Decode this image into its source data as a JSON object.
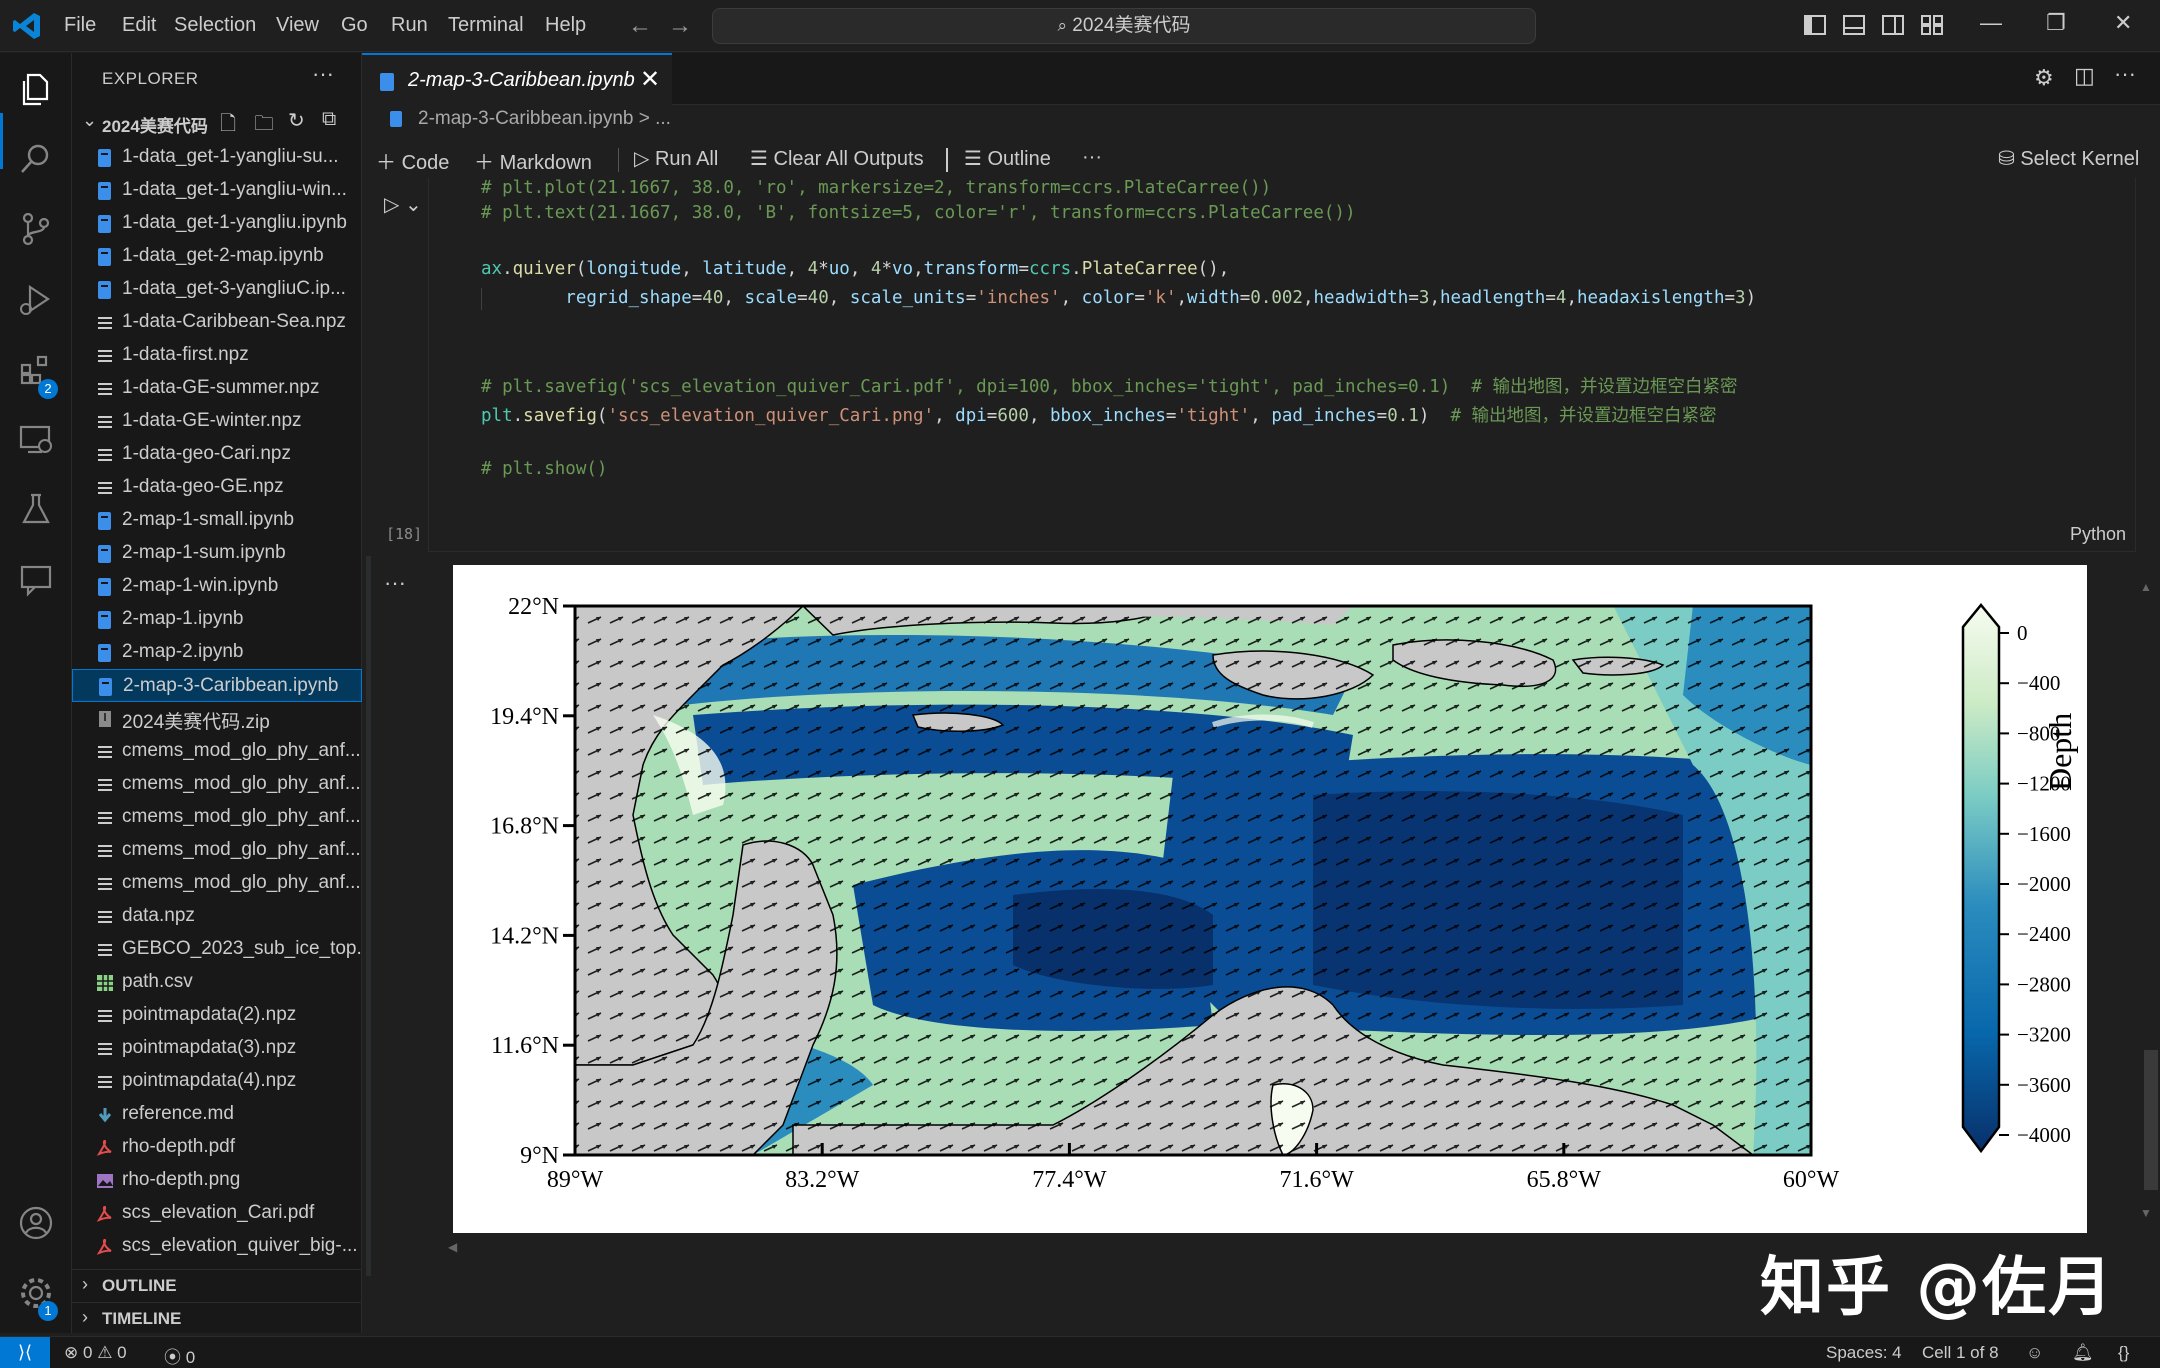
{
  "titlebar": {
    "menu": [
      "File",
      "Edit",
      "Selection",
      "View",
      "Go",
      "Run",
      "Terminal",
      "Help"
    ],
    "search_text": "2024美赛代码"
  },
  "activitybar": {
    "extensions_badge": "2",
    "settings_badge": "1"
  },
  "sidebar": {
    "title": "EXPLORER",
    "folder": "2024美赛代码",
    "files": [
      {
        "name": "1-data_get-1-yangliu-su...",
        "icon": "notebook"
      },
      {
        "name": "1-data_get-1-yangliu-win...",
        "icon": "notebook"
      },
      {
        "name": "1-data_get-1-yangliu.ipynb",
        "icon": "notebook"
      },
      {
        "name": "1-data_get-2-map.ipynb",
        "icon": "notebook"
      },
      {
        "name": "1-data_get-3-yangliuC.ip...",
        "icon": "notebook"
      },
      {
        "name": "1-data-Caribbean-Sea.npz",
        "icon": "lines"
      },
      {
        "name": "1-data-first.npz",
        "icon": "lines"
      },
      {
        "name": "1-data-GE-summer.npz",
        "icon": "lines"
      },
      {
        "name": "1-data-GE-winter.npz",
        "icon": "lines"
      },
      {
        "name": "1-data-geo-Cari.npz",
        "icon": "lines"
      },
      {
        "name": "1-data-geo-GE.npz",
        "icon": "lines"
      },
      {
        "name": "2-map-1-small.ipynb",
        "icon": "notebook"
      },
      {
        "name": "2-map-1-sum.ipynb",
        "icon": "notebook"
      },
      {
        "name": "2-map-1-win.ipynb",
        "icon": "notebook"
      },
      {
        "name": "2-map-1.ipynb",
        "icon": "notebook"
      },
      {
        "name": "2-map-2.ipynb",
        "icon": "notebook"
      },
      {
        "name": "2-map-3-Caribbean.ipynb",
        "icon": "notebook",
        "active": true
      },
      {
        "name": "2024美赛代码.zip",
        "icon": "zip"
      },
      {
        "name": "cmems_mod_glo_phy_anf...",
        "icon": "lines"
      },
      {
        "name": "cmems_mod_glo_phy_anf...",
        "icon": "lines"
      },
      {
        "name": "cmems_mod_glo_phy_anf...",
        "icon": "lines"
      },
      {
        "name": "cmems_mod_glo_phy_anf...",
        "icon": "lines"
      },
      {
        "name": "cmems_mod_glo_phy_anf...",
        "icon": "lines"
      },
      {
        "name": "data.npz",
        "icon": "lines"
      },
      {
        "name": "GEBCO_2023_sub_ice_top...",
        "icon": "lines"
      },
      {
        "name": "path.csv",
        "icon": "csv"
      },
      {
        "name": "pointmapdata(2).npz",
        "icon": "lines"
      },
      {
        "name": "pointmapdata(3).npz",
        "icon": "lines"
      },
      {
        "name": "pointmapdata(4).npz",
        "icon": "lines"
      },
      {
        "name": "reference.md",
        "icon": "markdown"
      },
      {
        "name": "rho-depth.pdf",
        "icon": "pdf"
      },
      {
        "name": "rho-depth.png",
        "icon": "image"
      },
      {
        "name": "scs_elevation_Cari.pdf",
        "icon": "pdf"
      },
      {
        "name": "scs_elevation_quiver_big-...",
        "icon": "pdf"
      }
    ],
    "sections": [
      "OUTLINE",
      "TIMELINE"
    ]
  },
  "editor": {
    "tab_label": "2-map-3-Caribbean.ipynb",
    "breadcrumb": "2-map-3-Caribbean.ipynb > ...",
    "toolbar": {
      "code": "Code",
      "markdown": "Markdown",
      "run_all": "Run All",
      "clear_outputs": "Clear All Outputs",
      "outline": "Outline",
      "select_kernel": "Select Kernel"
    },
    "cell": {
      "exec_count": "[18]",
      "language": "Python",
      "lines": [
        "# plt.plot(21.1667, 38.0, 'ro', markersize=2, transform=ccrs.PlateCarree())",
        "# plt.text(21.1667, 38.0, 'B', fontsize=5, color='r', transform=ccrs.PlateCarree())",
        "",
        "ax.quiver(longitude, latitude, 4*uo, 4*vo,transform=ccrs.PlateCarree(),",
        "        regrid_shape=40, scale=40, scale_units='inches', color='k',width=0.002,headwidth=3,headlength=4,headaxislength=3)",
        "",
        "",
        "# plt.savefig('scs_elevation_quiver_Cari.pdf', dpi=100, bbox_inches='tight', pad_inches=0.1)  # 输出地图，并设置边框空白紧密",
        "plt.savefig('scs_elevation_quiver_Cari.png', dpi=600, bbox_inches='tight', pad_inches=0.1)  # 输出地图，并设置边框空白紧密",
        "",
        "# plt.show()"
      ]
    }
  },
  "figure": {
    "lat_labels": [
      "22°N",
      "19.4°N",
      "16.8°N",
      "14.2°N",
      "11.6°N",
      "9°N"
    ],
    "lon_labels": [
      "89°W",
      "83.2°W",
      "77.4°W",
      "71.6°W",
      "65.8°W",
      "60°W"
    ],
    "colorbar_label": "Depth",
    "colorbar_ticks": [
      "0",
      "−400",
      "−800",
      "−1200",
      "−1600",
      "−2000",
      "−2400",
      "−2800",
      "−3200",
      "−3600",
      "−4000"
    ],
    "colors": {
      "deep": "#08306b",
      "mid": "#2b8cbe",
      "shallow": "#a8ddb5",
      "shore": "#f7fcf0",
      "land": "#c8c8c8"
    }
  },
  "watermark": "知乎 @佐月",
  "statusbar": {
    "errors": "0",
    "warnings": "0",
    "ports": "0",
    "spaces": "Spaces: 4",
    "cell_position": "Cell 1 of 8"
  }
}
